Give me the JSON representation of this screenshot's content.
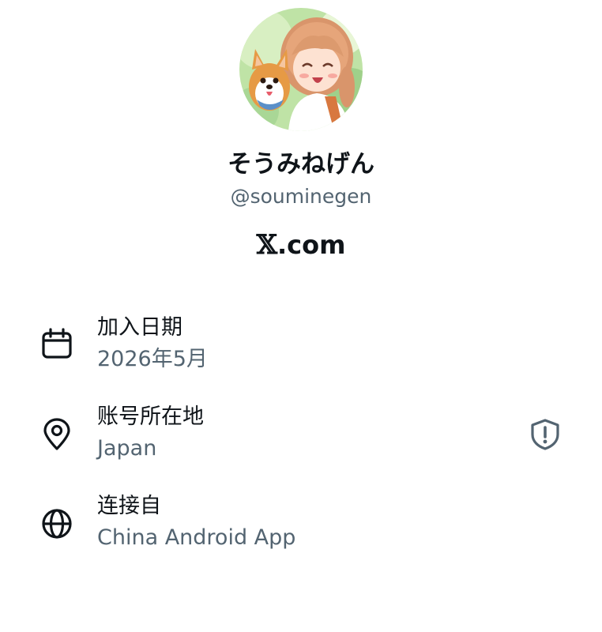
{
  "profile": {
    "display_name": "そうみねげん",
    "handle": "@souminegen",
    "site_prefix": "𝕏",
    "site_suffix": ".com"
  },
  "rows": [
    {
      "icon": "calendar-icon",
      "label": "加入日期",
      "value": "2026年5月"
    },
    {
      "icon": "location-pin-icon",
      "label": "账号所在地",
      "value": "Japan"
    },
    {
      "icon": "globe-icon",
      "label": "连接自",
      "value": "China Android App"
    }
  ],
  "icons": {
    "avatar": "anime-girl-with-corgi-avatar",
    "location_badge": "shield-alert-icon"
  },
  "colors": {
    "text_primary": "#0f1419",
    "text_secondary": "#536471",
    "background": "#ffffff"
  }
}
